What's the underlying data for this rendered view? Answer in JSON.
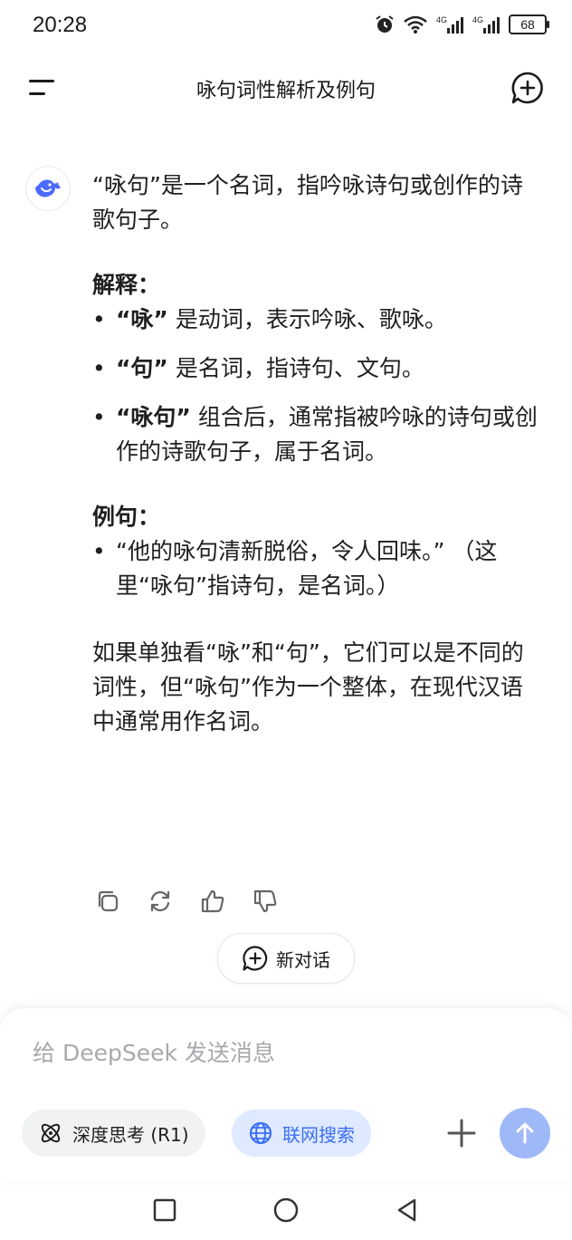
{
  "status": {
    "time": "20:28",
    "battery": "68",
    "network1": "4G",
    "network2": "4G"
  },
  "header": {
    "title": "咏句词性解析及例句"
  },
  "message": {
    "intro": "“咏句”是一个名词，指吟咏诗句或创作的诗歌句子。",
    "heading_explain": "解释：",
    "explain_items": [
      {
        "term": "“咏”",
        "text": " 是动词，表示吟咏、歌咏。"
      },
      {
        "term": "“句”",
        "text": " 是名词，指诗句、文句。"
      },
      {
        "term": "“咏句”",
        "text": " 组合后，通常指被吟咏的诗句或创作的诗歌句子，属于名词。"
      }
    ],
    "heading_example": "例句：",
    "example_items": [
      {
        "text": "“他的咏句清新脱俗，令人回味。” （这里“咏句”指诗句，是名词。）"
      }
    ],
    "summary": "如果单独看“咏”和“句”，它们可以是不同的词性，但“咏句”作为一个整体，在现代汉语中通常用作名词。"
  },
  "new_dialog": {
    "label": "新对话"
  },
  "composer": {
    "placeholder": "给 DeepSeek 发送消息",
    "think_label": "深度思考 (R1)",
    "search_label": "联网搜索"
  },
  "colors": {
    "accent": "#4d6bfe",
    "send": "#9fb8f8",
    "search_bg": "#dfe9ff",
    "search_fg": "#3b6ff5"
  }
}
